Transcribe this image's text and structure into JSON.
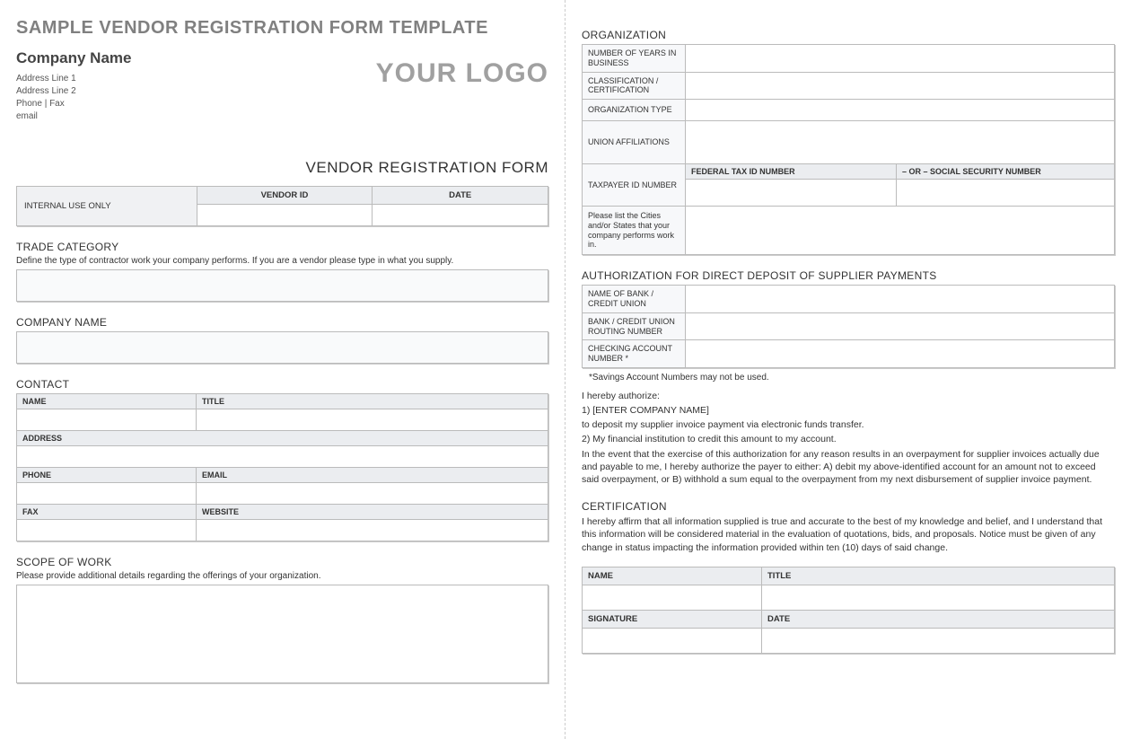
{
  "header": {
    "main_title": "SAMPLE VENDOR REGISTRATION FORM TEMPLATE",
    "company_name": "Company Name",
    "address1": "Address Line 1",
    "address2": "Address Line 2",
    "phone_fax": "Phone | Fax",
    "email": "email",
    "logo": "YOUR LOGO",
    "form_title": "VENDOR REGISTRATION FORM"
  },
  "internal": {
    "label": "INTERNAL USE ONLY",
    "vendor_id": "VENDOR ID",
    "date": "DATE"
  },
  "trade": {
    "title": "TRADE CATEGORY",
    "sub": "Define the type of contractor work your company performs. If you are a vendor please type in what you supply."
  },
  "company": {
    "title": "COMPANY NAME"
  },
  "contact": {
    "title": "CONTACT",
    "name": "NAME",
    "title_h": "TITLE",
    "address": "ADDRESS",
    "phone": "PHONE",
    "email": "EMAIL",
    "fax": "FAX",
    "website": "WEBSITE"
  },
  "scope": {
    "title": "SCOPE OF WORK",
    "sub": "Please provide additional details regarding the offerings of your organization."
  },
  "org": {
    "title": "ORGANIZATION",
    "years": "NUMBER OF YEARS IN BUSINESS",
    "classification": "CLASSIFICATION / CERTIFICATION",
    "type": "ORGANIZATION TYPE",
    "union": "UNION AFFILIATIONS",
    "tax": "TAXPAYER ID NUMBER",
    "fed": "FEDERAL TAX ID NUMBER",
    "or_ssn": "– OR –   SOCIAL SECURITY NUMBER",
    "cities": "Please list the Cities and/or States that your company performs work in."
  },
  "auth": {
    "title": "AUTHORIZATION FOR DIRECT DEPOSIT OF SUPPLIER PAYMENTS",
    "bank": "NAME OF BANK / CREDIT UNION",
    "routing": "BANK / CREDIT UNION ROUTING NUMBER",
    "checking": "CHECKING ACCOUNT NUMBER *",
    "note": "*Savings Account Numbers may not be used.",
    "hereby": "I hereby authorize:",
    "line1": "1) [ENTER COMPANY NAME]",
    "line1b": "to deposit my supplier invoice payment via electronic funds transfer.",
    "line2": "2) My financial institution to credit this amount to my account.",
    "line3": "In the event that the exercise of this authorization for any reason results in an overpayment for supplier invoices actually due and payable to me, I hereby authorize the payer to either: A) debit my above-identified account for an amount not to exceed said overpayment, or B) withhold a sum equal to the overpayment from my next disbursement of supplier invoice payment."
  },
  "cert": {
    "title": "CERTIFICATION",
    "text": "I hereby affirm that all information supplied is true and accurate to the best of my knowledge and belief, and I understand that this information will be considered material in the evaluation of quotations, bids, and proposals. Notice must be given of any change in status impacting the information provided within ten (10) days of said change.",
    "name": "NAME",
    "title_h": "TITLE",
    "signature": "SIGNATURE",
    "date": "DATE"
  }
}
